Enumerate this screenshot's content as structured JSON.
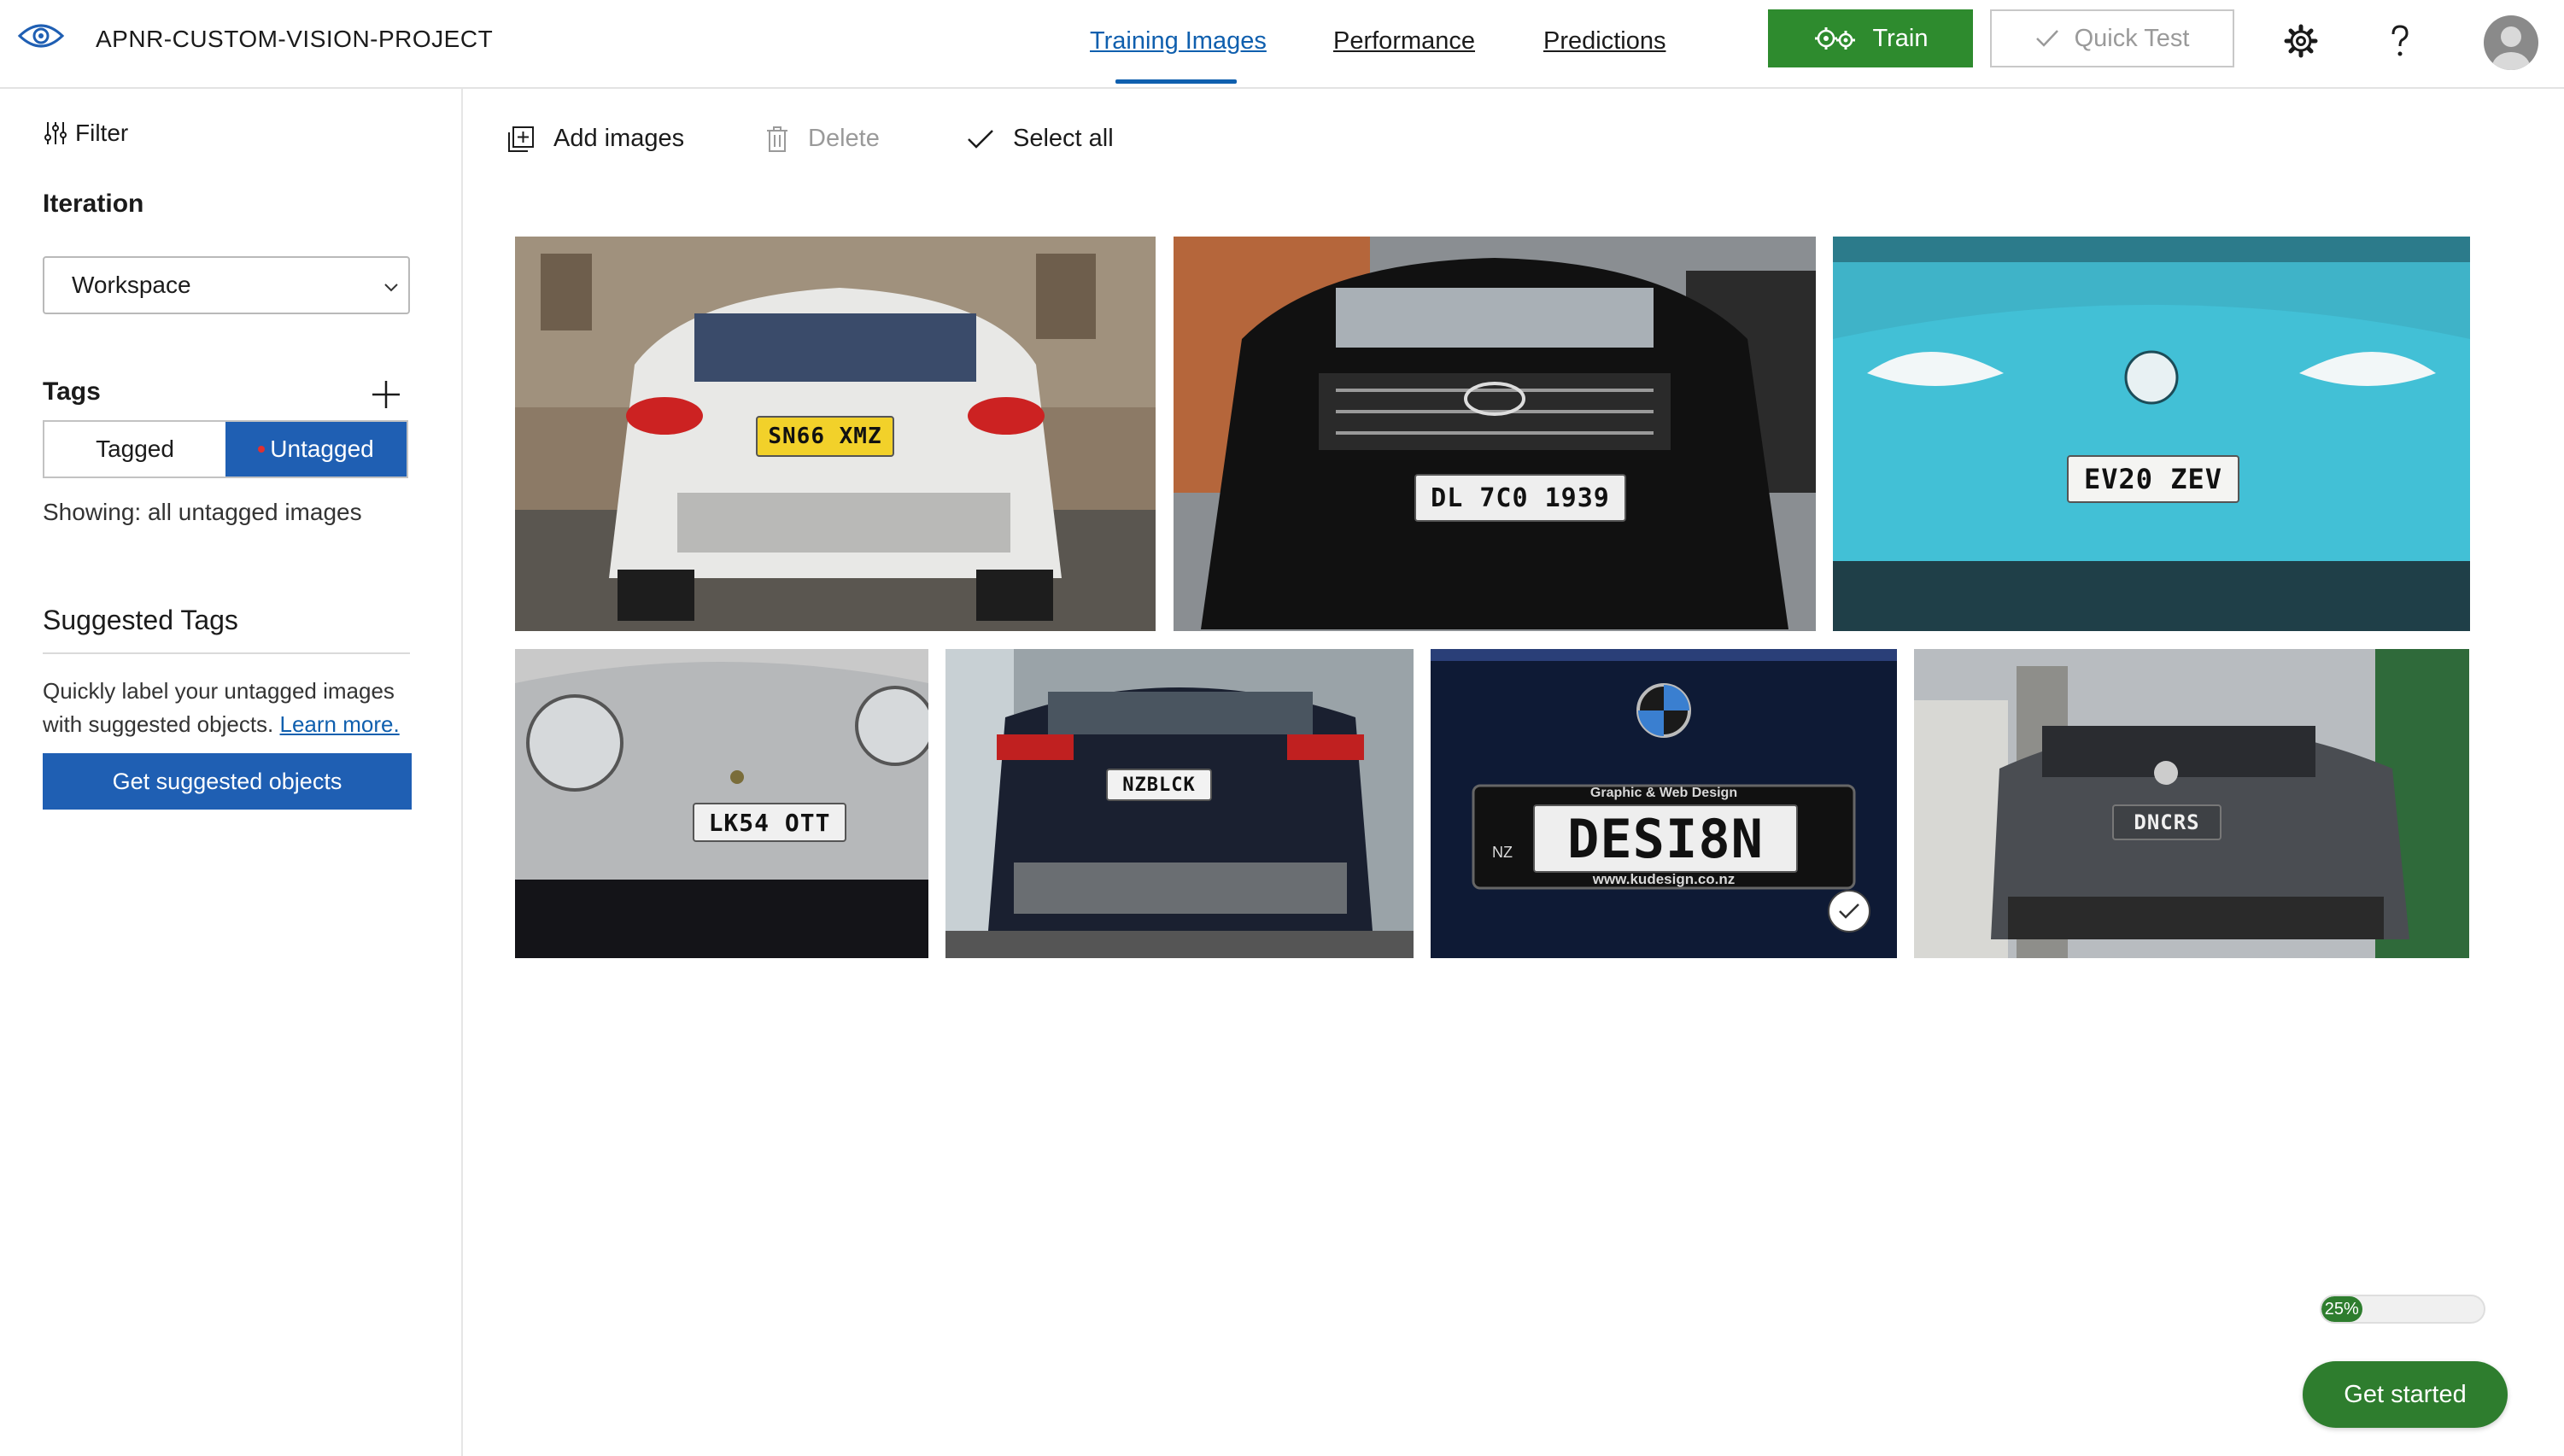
{
  "header": {
    "project_title": "APNR-CUSTOM-VISION-PROJECT",
    "tabs": [
      {
        "label": "Training Images",
        "active": true
      },
      {
        "label": "Performance",
        "active": false
      },
      {
        "label": "Predictions",
        "active": false
      }
    ],
    "train_label": "Train",
    "quick_test_label": "Quick Test",
    "icons": [
      "eye-logo-icon",
      "gear-icon",
      "help-icon",
      "avatar-icon"
    ]
  },
  "sidebar": {
    "filter_label": "Filter",
    "iteration_title": "Iteration",
    "iteration_value": "Workspace",
    "tags_title": "Tags",
    "tag_toggle": {
      "tagged": "Tagged",
      "untagged": "Untagged",
      "selected": "Untagged"
    },
    "showing_text": "Showing: all untagged images",
    "suggested_title": "Suggested Tags",
    "suggested_text": "Quickly label your untagged images with suggested objects.",
    "learn_more": "Learn more.",
    "suggested_button": "Get suggested objects"
  },
  "toolbar": {
    "add_images": "Add images",
    "delete": "Delete",
    "select_all": "Select all"
  },
  "images": [
    {
      "plate": "SN66 XMZ",
      "selected": false
    },
    {
      "plate": "DL 7C0 1939",
      "selected": false
    },
    {
      "plate": "EV20 ZEV",
      "selected": false
    },
    {
      "plate": "LK54 OTT",
      "selected": false
    },
    {
      "plate": "NZBLCK",
      "selected": false
    },
    {
      "plate": "DESI8N",
      "selected": true
    },
    {
      "plate": "DNCRS",
      "selected": false
    }
  ],
  "plate_extras": {
    "design_caption": "Graphic & Web Design",
    "design_url": "www.kudesign.co.nz",
    "design_country": "NZ"
  },
  "progress": {
    "value": 0.25,
    "label": "25%"
  },
  "get_started": "Get started",
  "colors": {
    "accent_blue": "#1f5fb3",
    "link_blue": "#0f5fae",
    "train_green": "#2e8b2e",
    "progress_green": "#2e7d2e"
  }
}
